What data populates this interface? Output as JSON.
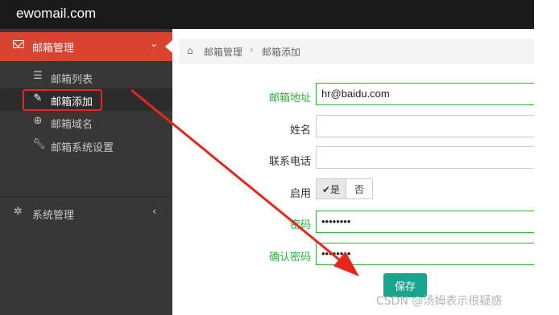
{
  "app": {
    "brand": "ewomail.com"
  },
  "sidebar": {
    "section": {
      "label": "邮箱管理",
      "icon": "envelope-icon",
      "chevron": "⌄"
    },
    "items": [
      {
        "label": "邮箱列表",
        "icon": "list-icon"
      },
      {
        "label": "邮箱添加",
        "icon": "pencil-icon"
      },
      {
        "label": "邮箱域名",
        "icon": "globe-icon"
      },
      {
        "label": "邮箱系统设置",
        "icon": "wrench-icon"
      }
    ],
    "system": {
      "label": "系统管理",
      "icon": "gear-icon",
      "chevron": "‹"
    }
  },
  "breadcrumb": {
    "items": [
      "邮箱管理",
      "邮箱添加"
    ],
    "separator": "›"
  },
  "form": {
    "email_label": "邮箱地址",
    "email_value": "hr@baidu.com",
    "name_label": "姓名",
    "name_value": "",
    "phone_label": "联系电话",
    "phone_value": "",
    "enable_label": "启用",
    "enable_yes": "✔是",
    "enable_no": "否",
    "password_label": "密码",
    "password_value": "••••••••",
    "confirm_label": "确认密码",
    "confirm_value": "••••••••",
    "save_label": "保存"
  },
  "watermark": "CSDN @汤姆表示很疑惑",
  "colors": {
    "accent_red": "#d9432f",
    "green": "#2bb03b",
    "save": "#19a58d"
  }
}
